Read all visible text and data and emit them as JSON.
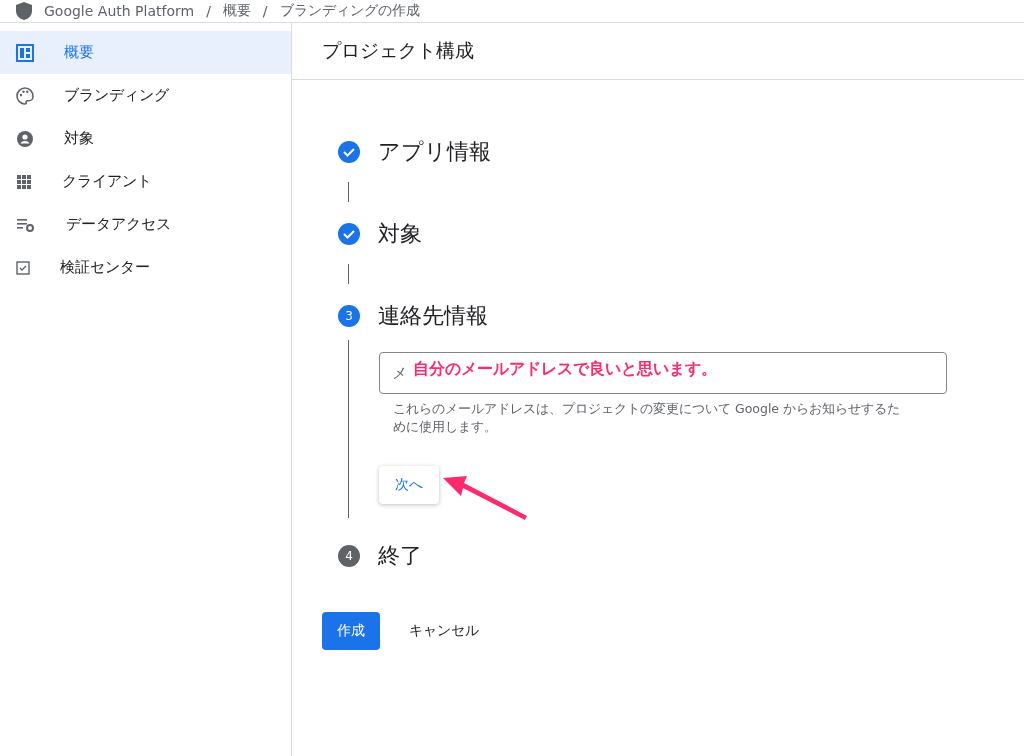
{
  "breadcrumb": {
    "product": "Google Auth Platform",
    "items": [
      "概要",
      "ブランディングの作成"
    ],
    "separator": "/"
  },
  "sidebar": {
    "items": [
      {
        "label": "概要",
        "selected": true
      },
      {
        "label": "ブランディング",
        "selected": false
      },
      {
        "label": "対象",
        "selected": false
      },
      {
        "label": "クライアント",
        "selected": false
      },
      {
        "label": "データアクセス",
        "selected": false
      },
      {
        "label": "検証センター",
        "selected": false
      }
    ]
  },
  "page": {
    "title": "プロジェクト構成"
  },
  "steps": [
    {
      "kind": "done",
      "title": "アプリ情報"
    },
    {
      "kind": "done",
      "title": "対象"
    },
    {
      "kind": "active",
      "number": "3",
      "title": "連絡先情報",
      "field": {
        "value": "メ",
        "hint": "これらのメールアドレスは、プロジェクトの変更について Google からお知らせするために使用します。"
      },
      "annotation": "自分のメールアドレスで良いと思います。",
      "next_button": "次へ"
    },
    {
      "kind": "pending",
      "number": "4",
      "title": "終了"
    }
  ],
  "actions": {
    "create": "作成",
    "cancel": "キャンセル"
  }
}
